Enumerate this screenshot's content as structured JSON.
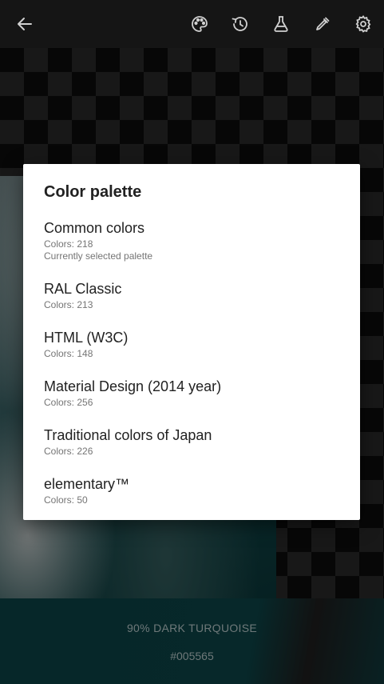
{
  "appbar": {
    "icons": [
      "back-arrow-icon",
      "palette-icon",
      "history-icon",
      "flask-icon",
      "eyedropper-icon",
      "gear-icon"
    ]
  },
  "colors": {
    "background": "#151515",
    "icon": "#d0d0d0",
    "color_bar": "#0a3c3f",
    "color_text": "#a9b9ba",
    "dialog_bg": "#ffffff"
  },
  "dialog": {
    "title": "Color palette",
    "options": [
      {
        "name": "Common colors",
        "count": "Colors: 218",
        "note": "Currently selected palette"
      },
      {
        "name": "RAL Classic",
        "count": "Colors: 213"
      },
      {
        "name": "HTML (W3C)",
        "count": "Colors: 148"
      },
      {
        "name": "Material Design (2014 year)",
        "count": "Colors: 256"
      },
      {
        "name": "Traditional colors of Japan",
        "count": "Colors: 226"
      },
      {
        "name": "elementary™",
        "count": "Colors: 50"
      }
    ]
  },
  "color_info": {
    "name": "90% DARK TURQUOISE",
    "hex": "#005565"
  }
}
